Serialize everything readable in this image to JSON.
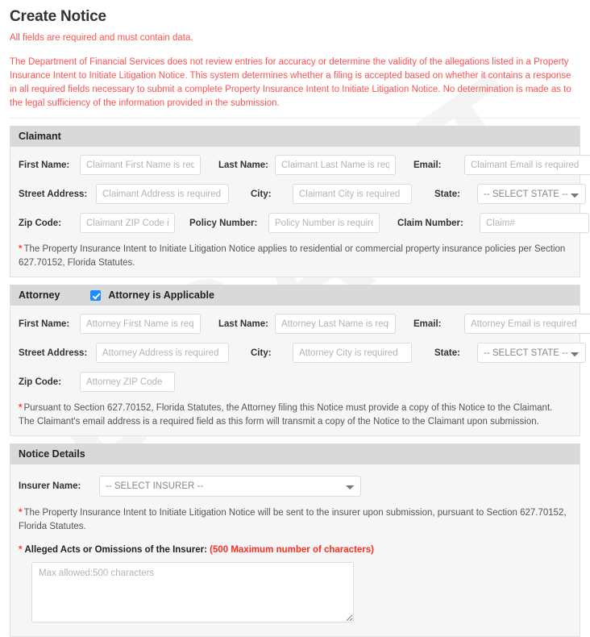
{
  "page": {
    "title": "Create Notice",
    "required_note": "All fields are required and must contain data.",
    "disclaimer": "The Department of Financial Services does not review entries for accuracy or determine the validity of the allegations listed in a Property Insurance Intent to Initiate Litigation Notice. This system determines whether a filing is accepted based on whether it contains a response in all required fields necessary to submit a complete Property Insurance Intent to Initiate Litigation Notice. No determination is made as to the legal sufficiency of the information provided in the submission.",
    "watermark": "DRAFT"
  },
  "claimant": {
    "header": "Claimant",
    "fields": {
      "first_name": {
        "label": "First Name:",
        "placeholder": "Claimant First Name is required",
        "value": ""
      },
      "last_name": {
        "label": "Last Name:",
        "placeholder": "Claimant Last Name is required",
        "value": ""
      },
      "email": {
        "label": "Email:",
        "placeholder": "Claimant Email is required",
        "value": ""
      },
      "street_address": {
        "label": "Street Address:",
        "placeholder": "Claimant Address is required",
        "value": ""
      },
      "city": {
        "label": "City:",
        "placeholder": "Claimant City is required",
        "value": ""
      },
      "state": {
        "label": "State:",
        "selected": "-- SELECT STATE --"
      },
      "zip_code": {
        "label": "Zip Code:",
        "placeholder": "Claimant ZIP Code is required",
        "value": ""
      },
      "policy_number": {
        "label": "Policy Number:",
        "placeholder": "Policy Number is required",
        "value": ""
      },
      "claim_number": {
        "label": "Claim Number:",
        "placeholder": "Claim#",
        "value": ""
      }
    },
    "footnote": "The Property Insurance Intent to Initiate Litigation Notice applies to residential or commercial property insurance policies per Section 627.70152, Florida Statutes."
  },
  "attorney": {
    "header": "Attorney",
    "applicable_label": "Attorney is Applicable",
    "applicable_checked": true,
    "fields": {
      "first_name": {
        "label": "First Name:",
        "placeholder": "Attorney First Name is required",
        "value": ""
      },
      "last_name": {
        "label": "Last Name:",
        "placeholder": "Attorney Last Name is required",
        "value": ""
      },
      "email": {
        "label": "Email:",
        "placeholder": "Attorney Email is required",
        "value": ""
      },
      "street_address": {
        "label": "Street Address:",
        "placeholder": "Attorney Address is required",
        "value": ""
      },
      "city": {
        "label": "City:",
        "placeholder": "Attorney City is required",
        "value": ""
      },
      "state": {
        "label": "State:",
        "selected": "-- SELECT STATE --"
      },
      "zip_code": {
        "label": "Zip Code:",
        "placeholder": "Attorney ZIP Code",
        "value": ""
      }
    },
    "footnote": "Pursuant to Section 627.70152, Florida Statutes, the Attorney filing this Notice must provide a copy of this Notice to the Claimant. The Claimant's email address is a required field as this form will transmit a copy of the Notice to the Claimant upon submission."
  },
  "notice_details": {
    "header": "Notice Details",
    "insurer": {
      "label": "Insurer Name:",
      "selected": "-- SELECT INSURER --"
    },
    "footnote": "The Property Insurance Intent to Initiate Litigation Notice will be sent to the insurer upon submission, pursuant to Section 627.70152, Florida Statutes.",
    "alleged": {
      "label": "Alleged Acts or Omissions of the Insurer:",
      "max_chars_note": "(500 Maximum number of characters)",
      "placeholder": "Max allowed:500 characters",
      "value": ""
    }
  },
  "colors": {
    "red_text": "#ff5252",
    "red_star": "#ff3b30",
    "checkbox_blue": "#1a8cff",
    "panel_header_bg": "#d9d9d9",
    "panel_body_bg": "#f6f6f6"
  }
}
